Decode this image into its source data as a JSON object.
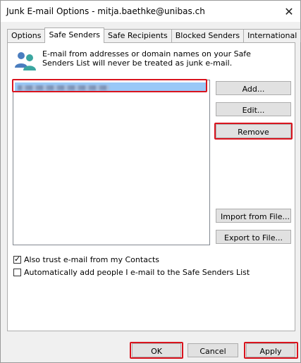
{
  "window": {
    "title": "Junk E-mail Options - mitja.baethke@unibas.ch",
    "close_glyph": "✕"
  },
  "tabs": [
    {
      "label": "Options",
      "active": false
    },
    {
      "label": "Safe Senders",
      "active": true
    },
    {
      "label": "Safe Recipients",
      "active": false
    },
    {
      "label": "Blocked Senders",
      "active": false
    },
    {
      "label": "International",
      "active": false
    }
  ],
  "safe_senders": {
    "icon": "people-icon",
    "description": "E-mail from addresses or domain names on your Safe Senders List will never be treated as junk e-mail.",
    "list_selected_item": "",
    "buttons": {
      "add": "Add...",
      "edit": "Edit...",
      "remove": "Remove",
      "import": "Import from File...",
      "export": "Export to File..."
    },
    "checkboxes": [
      {
        "label": "Also trust e-mail from my Contacts",
        "checked": true
      },
      {
        "label": "Automatically add people I e-mail to the Safe Senders List",
        "checked": false
      }
    ]
  },
  "footer": {
    "ok": "OK",
    "cancel": "Cancel",
    "apply": "Apply"
  },
  "colors": {
    "highlight": "#d9141e",
    "selection": "#99c8f7",
    "icon_blue": "#4a7dbf",
    "icon_teal": "#3aa6a0"
  }
}
